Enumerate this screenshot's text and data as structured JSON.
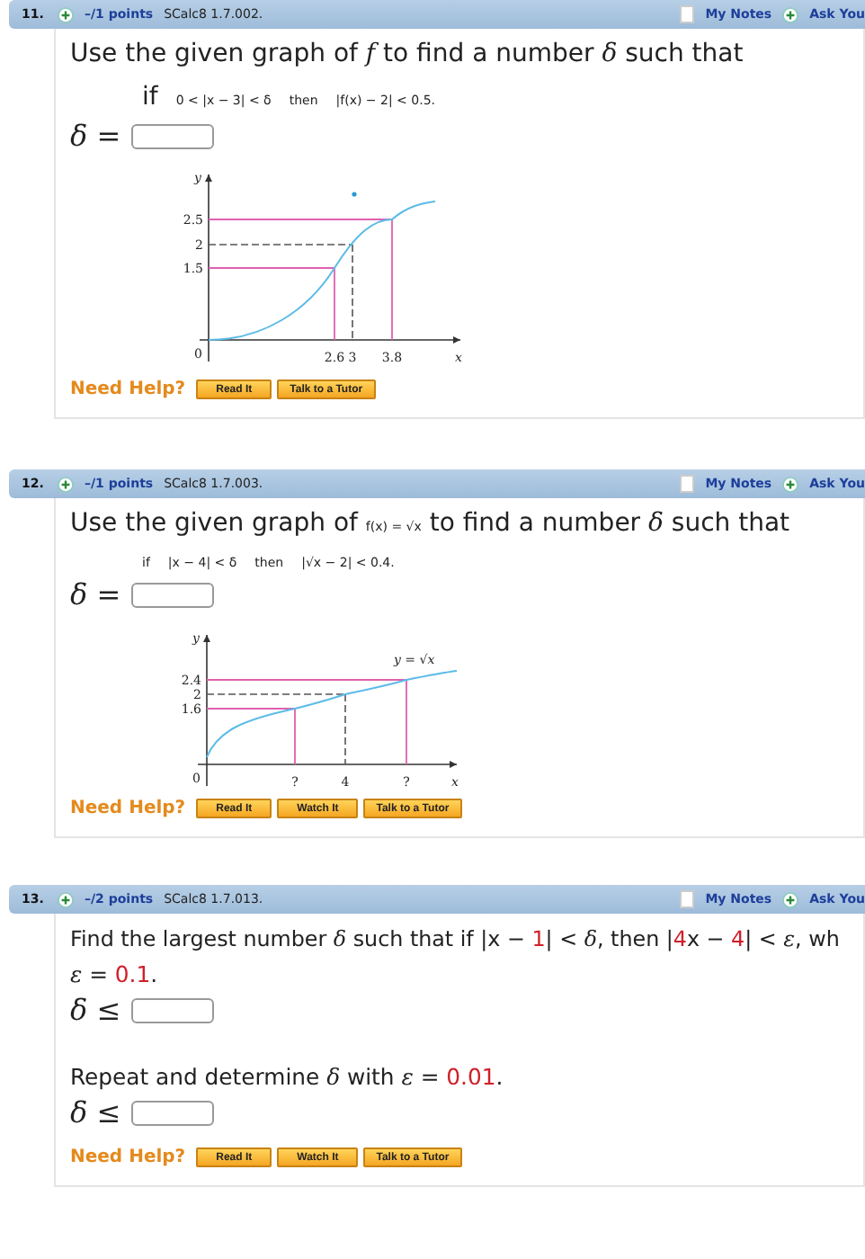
{
  "questions": [
    {
      "number": "11.",
      "points": "–/1 points",
      "source": "SCalc8 1.7.002.",
      "notes": "My Notes",
      "ask": "Ask You",
      "prompt": [
        {
          "kind": "text",
          "text": "Use the given graph of "
        },
        {
          "kind": "math",
          "text": "f"
        },
        {
          "kind": "text",
          "text": " to find a number "
        },
        {
          "kind": "math",
          "text": "δ"
        },
        {
          "kind": "text",
          "text": " such that"
        }
      ],
      "condition": [
        "if",
        "0 < |x − 3| < δ",
        "then",
        "|f(x) − 2| < 0.5."
      ],
      "answers": [
        {
          "label": "δ ="
        }
      ],
      "figure": {
        "kind": "s-curve",
        "y_axis": "y",
        "x_axis": "x",
        "origin": "0",
        "y_ticks": [
          "2.5",
          "2",
          "1.5"
        ],
        "x_ticks": [
          "2.6",
          "3",
          "3.8"
        ]
      },
      "help": "Need Help?",
      "buttons": [
        "Read It",
        "Talk to a Tutor"
      ]
    },
    {
      "number": "12.",
      "points": "–/1 points",
      "source": "SCalc8 1.7.003.",
      "notes": "My Notes",
      "ask": "Ask You",
      "prompt": [
        {
          "kind": "text",
          "text": "Use the given graph of "
        },
        {
          "kind": "small",
          "text": "f(x) = √x"
        },
        {
          "kind": "text",
          "text": " to find a number "
        },
        {
          "kind": "math",
          "text": "δ"
        },
        {
          "kind": "text",
          "text": " such that"
        }
      ],
      "condition": [
        "if",
        "|x − 4| < δ",
        "then",
        "|√x − 2| < 0.4."
      ],
      "answers": [
        {
          "label": "δ ="
        }
      ],
      "figure": {
        "kind": "sqrt",
        "y_axis": "y",
        "x_axis": "x",
        "origin": "0",
        "curve_label": "y = √x",
        "y_ticks": [
          "2.4",
          "2",
          "1.6"
        ],
        "x_ticks": [
          "?",
          "4",
          "?"
        ]
      },
      "help": "Need Help?",
      "buttons": [
        "Read It",
        "Watch It",
        "Talk to a Tutor"
      ]
    },
    {
      "number": "13.",
      "points": "–/2 points",
      "source": "SCalc8 1.7.013.",
      "notes": "My Notes",
      "ask": "Ask You",
      "prompt": [
        {
          "kind": "text",
          "text": "Find the largest number "
        },
        {
          "kind": "math",
          "text": "δ"
        },
        {
          "kind": "text",
          "text": " such that if |x − "
        },
        {
          "kind": "red",
          "text": "1"
        },
        {
          "kind": "text",
          "text": "| < "
        },
        {
          "kind": "math",
          "text": "δ"
        },
        {
          "kind": "text",
          "text": ", then |"
        },
        {
          "kind": "red",
          "text": "4"
        },
        {
          "kind": "text",
          "text": "x − "
        },
        {
          "kind": "red",
          "text": "4"
        },
        {
          "kind": "text",
          "text": "| < "
        },
        {
          "kind": "math",
          "text": "ε"
        },
        {
          "kind": "text",
          "text": ", wh"
        }
      ],
      "answers": [
        {
          "before": [
            {
              "kind": "math",
              "text": "ε"
            },
            {
              "kind": "text",
              "text": " = "
            },
            {
              "kind": "red",
              "text": "0.1"
            },
            {
              "kind": "text",
              "text": "."
            }
          ],
          "label": "δ ≤"
        },
        {
          "before": [
            {
              "kind": "text",
              "text": "Repeat and determine "
            },
            {
              "kind": "math",
              "text": "δ"
            },
            {
              "kind": "text",
              "text": " with "
            },
            {
              "kind": "math",
              "text": "ε"
            },
            {
              "kind": "text",
              "text": " = "
            },
            {
              "kind": "red",
              "text": "0.01"
            },
            {
              "kind": "text",
              "text": "."
            }
          ],
          "label": "δ ≤"
        }
      ],
      "help": "Need Help?",
      "buttons": [
        "Read It",
        "Watch It",
        "Talk to a Tutor"
      ]
    }
  ]
}
